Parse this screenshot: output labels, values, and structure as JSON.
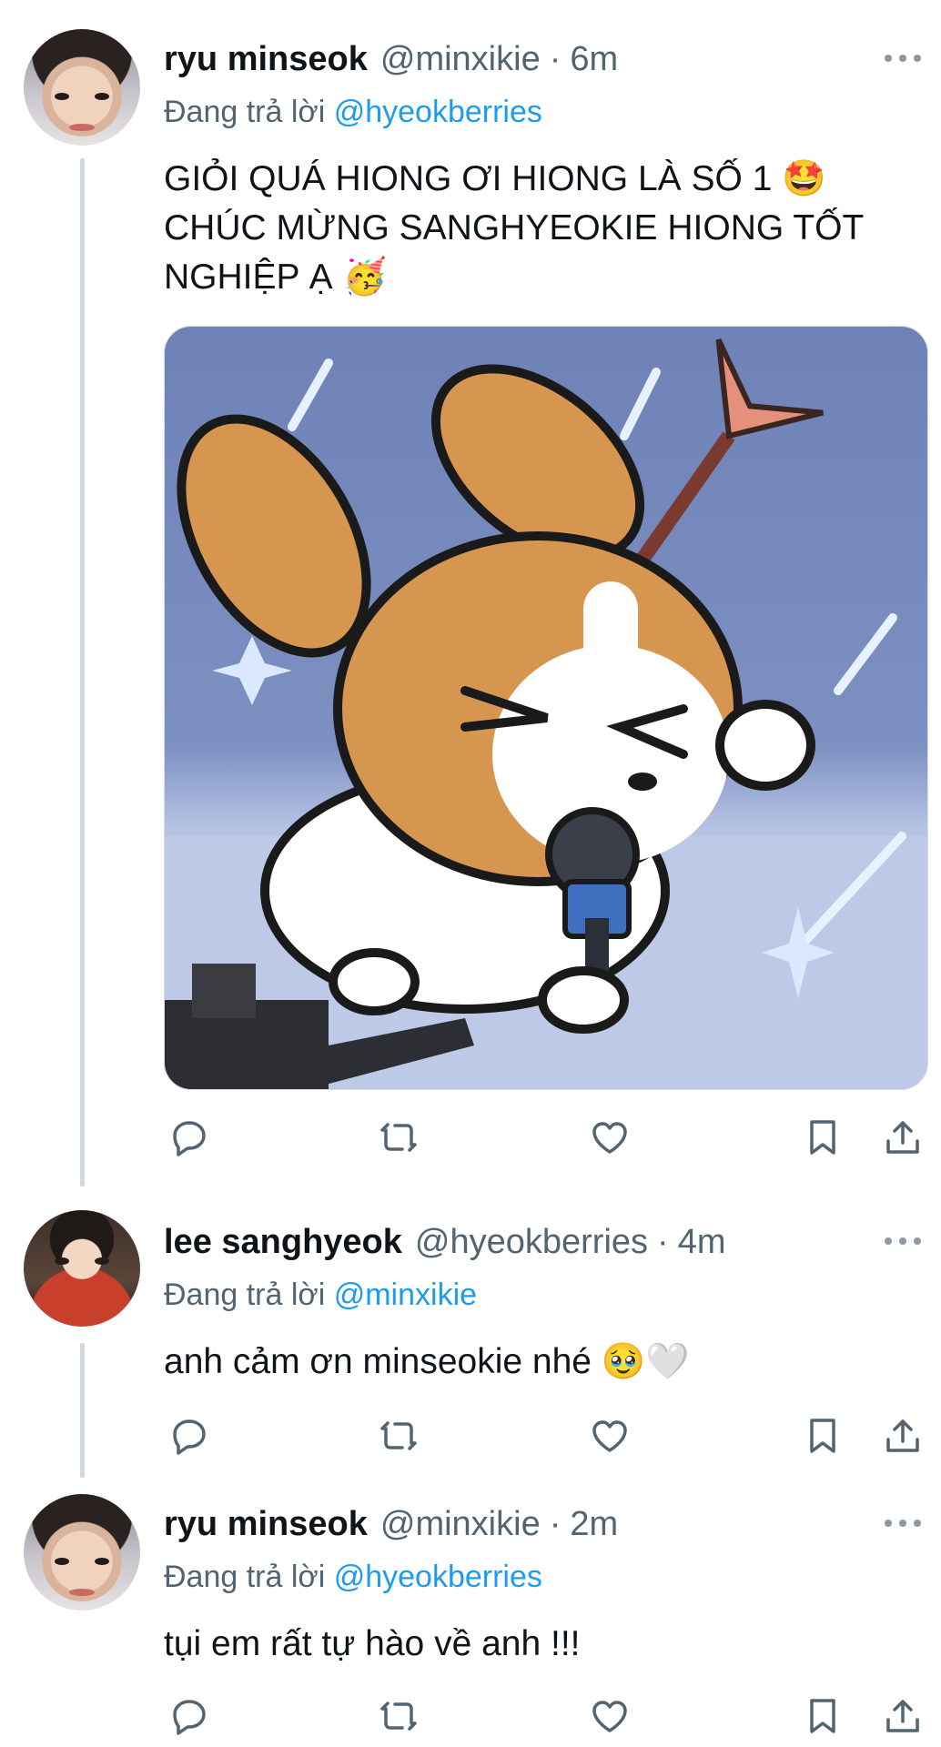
{
  "tweets": [
    {
      "name": "ryu minseok",
      "handle": "@minxikie",
      "time": "6m",
      "replying_prefix": "Đang trả lời",
      "replying_to": "@hyeokberries",
      "text": "GIỎI QUÁ HIONG ƠI HIONG LÀ SỐ 1 🤩 CHÚC MỪNG SANGHYEOKIE HIONG TỐT NGHIỆP Ạ 🥳",
      "avatar": "avatar-ryu-minseok",
      "media": "corgi-singing-cartoon"
    },
    {
      "name": "lee sanghyeok",
      "handle": "@hyeokberries",
      "time": "4m",
      "replying_prefix": "Đang trả lời",
      "replying_to": "@minxikie",
      "text": "anh cảm ơn minseokie nhé 🥹🤍",
      "avatar": "avatar-lee-sanghyeok"
    },
    {
      "name": "ryu minseok",
      "handle": "@minxikie",
      "time": "2m",
      "replying_prefix": "Đang trả lời",
      "replying_to": "@hyeokberries",
      "text": "tụi em rất tự hào về anh !!!",
      "avatar": "avatar-ryu-minseok"
    }
  ],
  "separator": "·",
  "icons": [
    "reply-icon",
    "retweet-icon",
    "like-icon",
    "bookmark-icon",
    "share-icon",
    "more-icon"
  ],
  "colors": {
    "link": "#1d9bf0",
    "secondary": "#536471",
    "thread_line": "#cfd9de",
    "icon": "#536471"
  }
}
